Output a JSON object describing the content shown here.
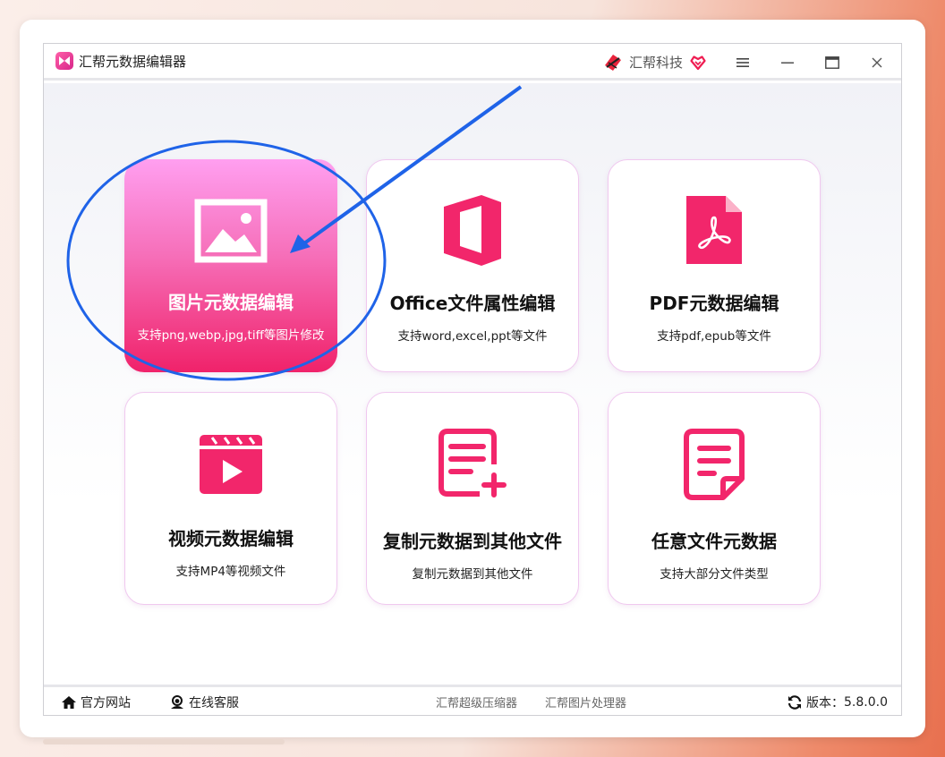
{
  "window": {
    "title": "汇帮元数据编辑器",
    "brand_name": "汇帮科技",
    "menu_icon": "hamburger-icon",
    "minimize_icon": "minimize-icon",
    "maximize_icon": "maximize-icon",
    "close_icon": "close-icon"
  },
  "cards": [
    {
      "title": "图片元数据编辑",
      "subtitle": "支持png,webp,jpg,tiff等图片修改",
      "icon": "image-icon",
      "selected": true
    },
    {
      "title": "Office文件属性编辑",
      "subtitle": "支持word,excel,ppt等文件",
      "icon": "office-icon",
      "selected": false
    },
    {
      "title": "PDF元数据编辑",
      "subtitle": "支持pdf,epub等文件",
      "icon": "pdf-icon",
      "selected": false
    },
    {
      "title": "视频元数据编辑",
      "subtitle": "支持MP4等视频文件",
      "icon": "video-clapper-icon",
      "selected": false
    },
    {
      "title": "复制元数据到其他文件",
      "subtitle": "复制元数据到其他文件",
      "icon": "list-add-icon",
      "selected": false
    },
    {
      "title": "任意文件元数据",
      "subtitle": "支持大部分文件类型",
      "icon": "document-icon",
      "selected": false
    }
  ],
  "statusbar": {
    "home_label": "官方网站",
    "support_label": "在线客服",
    "link1": "汇帮超级压缩器",
    "link2": "汇帮图片处理器",
    "version_label": "版本：",
    "version": "5.8.0.0"
  },
  "colors": {
    "accent": "#f0226a",
    "icon_pink": "#f2266b",
    "annotation_blue": "#1f63e8"
  }
}
